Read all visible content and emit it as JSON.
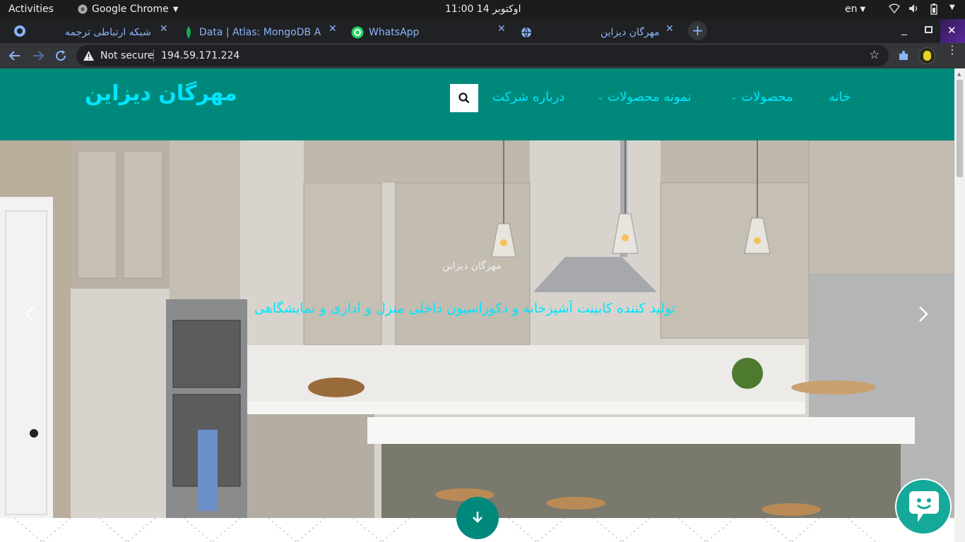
{
  "system_bar": {
    "activities": "Activities",
    "app_name": "Google Chrome",
    "clock": "11:00  14 اوکتوبر",
    "lang": "en"
  },
  "tabs": [
    {
      "label": "شبکه ارتباطی ترجمه"
    },
    {
      "label": "Data | Atlas: MongoDB At"
    },
    {
      "label": "WhatsApp"
    },
    {
      "label": "مهرگان دیزاین"
    }
  ],
  "toolbar": {
    "security_label": "Not secure",
    "url": "194.59.171.224"
  },
  "site": {
    "brand": "مهرگان دیزاین",
    "nav": {
      "home": "خانه",
      "products": "محصولات",
      "samples": "نمونه محصولات",
      "about": "درباره شرکت"
    },
    "hero": {
      "subtitle": "مهرگان دیزاین",
      "tagline": "تولید کننده کابینت آشپزخانه و دکوراسیون داخلی منزل و اداری و نمایشگاهی"
    }
  },
  "colors": {
    "nav_bg": "#00897b",
    "accent_text": "#00e5ff",
    "chat_widget": "#15a99a"
  }
}
